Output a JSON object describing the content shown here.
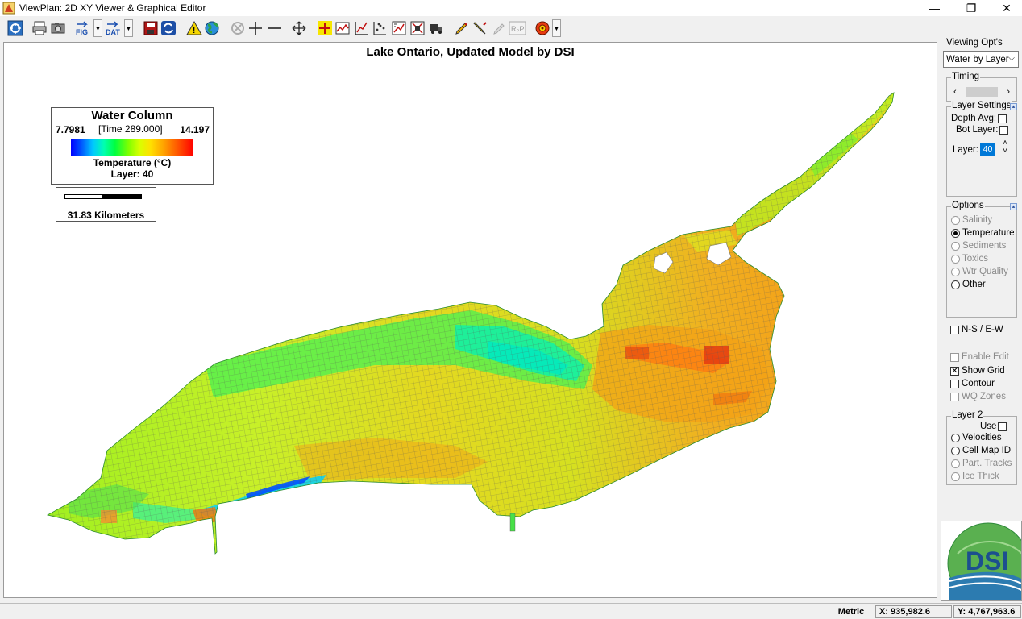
{
  "window": {
    "title": "ViewPlan: 2D XY Viewer & Graphical Editor",
    "minimize": "—",
    "restore": "❐",
    "close": "✕"
  },
  "toolbar": {
    "icons": [
      "zoom-extents-icon",
      "print-icon",
      "camera-icon",
      "fig-export-icon",
      "dat-export-icon",
      "save-icon",
      "refresh-icon",
      "warning-icon",
      "globe-icon",
      "pan-disabled-icon",
      "add-point-icon",
      "minus-icon",
      "move-icon",
      "crosshair-icon",
      "time-series-icon",
      "profile-icon",
      "points-icon",
      "vector-plot-icon",
      "cell-plot-icon",
      "truck-icon",
      "pen-icon",
      "pencil-icon",
      "disabled-draw-icon",
      "rp-icon",
      "settings-icon"
    ],
    "fig_label": "FIG",
    "dat_label": "DAT",
    "rp_label": "RₚP"
  },
  "map": {
    "title": "Lake Ontario, Updated Model by DSI",
    "legend": {
      "title": "Water Column",
      "min": "7.7981",
      "time": "[Time 289.000]",
      "max": "14.197",
      "parameter": "Temperature (°C)",
      "layer": "Layer: 40"
    },
    "scale": {
      "label": "31.83 Kilometers"
    },
    "colors": {
      "cold": "#0000ff",
      "cool": "#00e8a0",
      "mid": "#80ff00",
      "warm": "#ffe000",
      "hot": "#ff3000",
      "grid": "#6a6a6a"
    }
  },
  "panel": {
    "viewing_opts_label": "Viewing Opt's",
    "viewing_mode": "Water by Layer",
    "timing_label": "Timing",
    "layer_settings_label": "Layer Settings",
    "depth_avg_label": "Depth Avg:",
    "bot_layer_label": "Bot Layer:",
    "layer_label": "Layer:",
    "layer_value": "40",
    "options_label": "Options",
    "options": [
      {
        "label": "Salinity",
        "selected": false,
        "enabled": false
      },
      {
        "label": "Temperature",
        "selected": true,
        "enabled": true
      },
      {
        "label": "Sediments",
        "selected": false,
        "enabled": false
      },
      {
        "label": "Toxics",
        "selected": false,
        "enabled": false
      },
      {
        "label": "Wtr Quality",
        "selected": false,
        "enabled": false
      },
      {
        "label": "Other",
        "selected": false,
        "enabled": true
      }
    ],
    "ns_ew_label": "N-S / E-W",
    "enable_edit_label": "Enable Edit",
    "show_grid_label": "Show Grid",
    "contour_label": "Contour",
    "wq_zones_label": "WQ Zones",
    "layer2_label": "Layer 2",
    "use_label": "Use",
    "layer2_options": [
      {
        "label": "Velocities",
        "enabled": true
      },
      {
        "label": "Cell Map ID",
        "enabled": true
      },
      {
        "label": "Part. Tracks",
        "enabled": false
      },
      {
        "label": "Ice Thick",
        "enabled": false
      }
    ],
    "logo_text": "DSI"
  },
  "status": {
    "units": "Metric",
    "x": "X: 935,982.6",
    "y": "Y: 4,767,963.6"
  }
}
